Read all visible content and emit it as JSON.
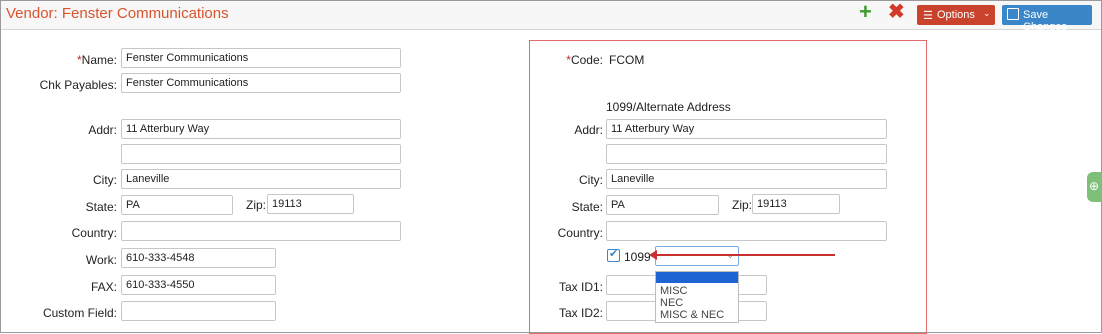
{
  "header": {
    "title": "Vendor: Fenster Communications",
    "options_label": "Options",
    "save_label": "Save Changes"
  },
  "left": {
    "name_label": "Name:",
    "name_value": "Fenster Communications",
    "chk_payables_label": "Chk Payables:",
    "chk_payables_value": "Fenster Communications",
    "addr_label": "Addr:",
    "addr1_value": "11 Atterbury Way",
    "addr2_value": "",
    "city_label": "City:",
    "city_value": "Laneville",
    "state_label": "State:",
    "state_value": "PA",
    "zip_label": "Zip:",
    "zip_value": "19113",
    "country_label": "Country:",
    "country_value": "",
    "work_label": "Work:",
    "work_value": "610-333-4548",
    "fax_label": "FAX:",
    "fax_value": "610-333-4550",
    "custom_label": "Custom Field:",
    "custom_value": ""
  },
  "right": {
    "code_label": "Code:",
    "code_value": "FCOM",
    "alt_heading": "1099/Alternate Address",
    "addr_label": "Addr:",
    "addr1_value": "11 Atterbury Way",
    "addr2_value": "",
    "city_label": "City:",
    "city_value": "Laneville",
    "state_label": "State:",
    "state_value": "PA",
    "zip_label": "Zip:",
    "zip_value": "19113",
    "country_label": "Country:",
    "country_value": "",
    "checkbox_label": "1099",
    "checkbox_checked": true,
    "select_value": "",
    "select_options": [
      "MISC",
      "NEC",
      "MISC & NEC"
    ],
    "taxid1_label": "Tax ID1:",
    "taxid2_label": "Tax ID2:"
  },
  "colors": {
    "title": "#d8542f",
    "options_button": "#c9432c",
    "save_button": "#3a86c8",
    "highlight": "#1e64d2",
    "annotation": "#c83030"
  }
}
